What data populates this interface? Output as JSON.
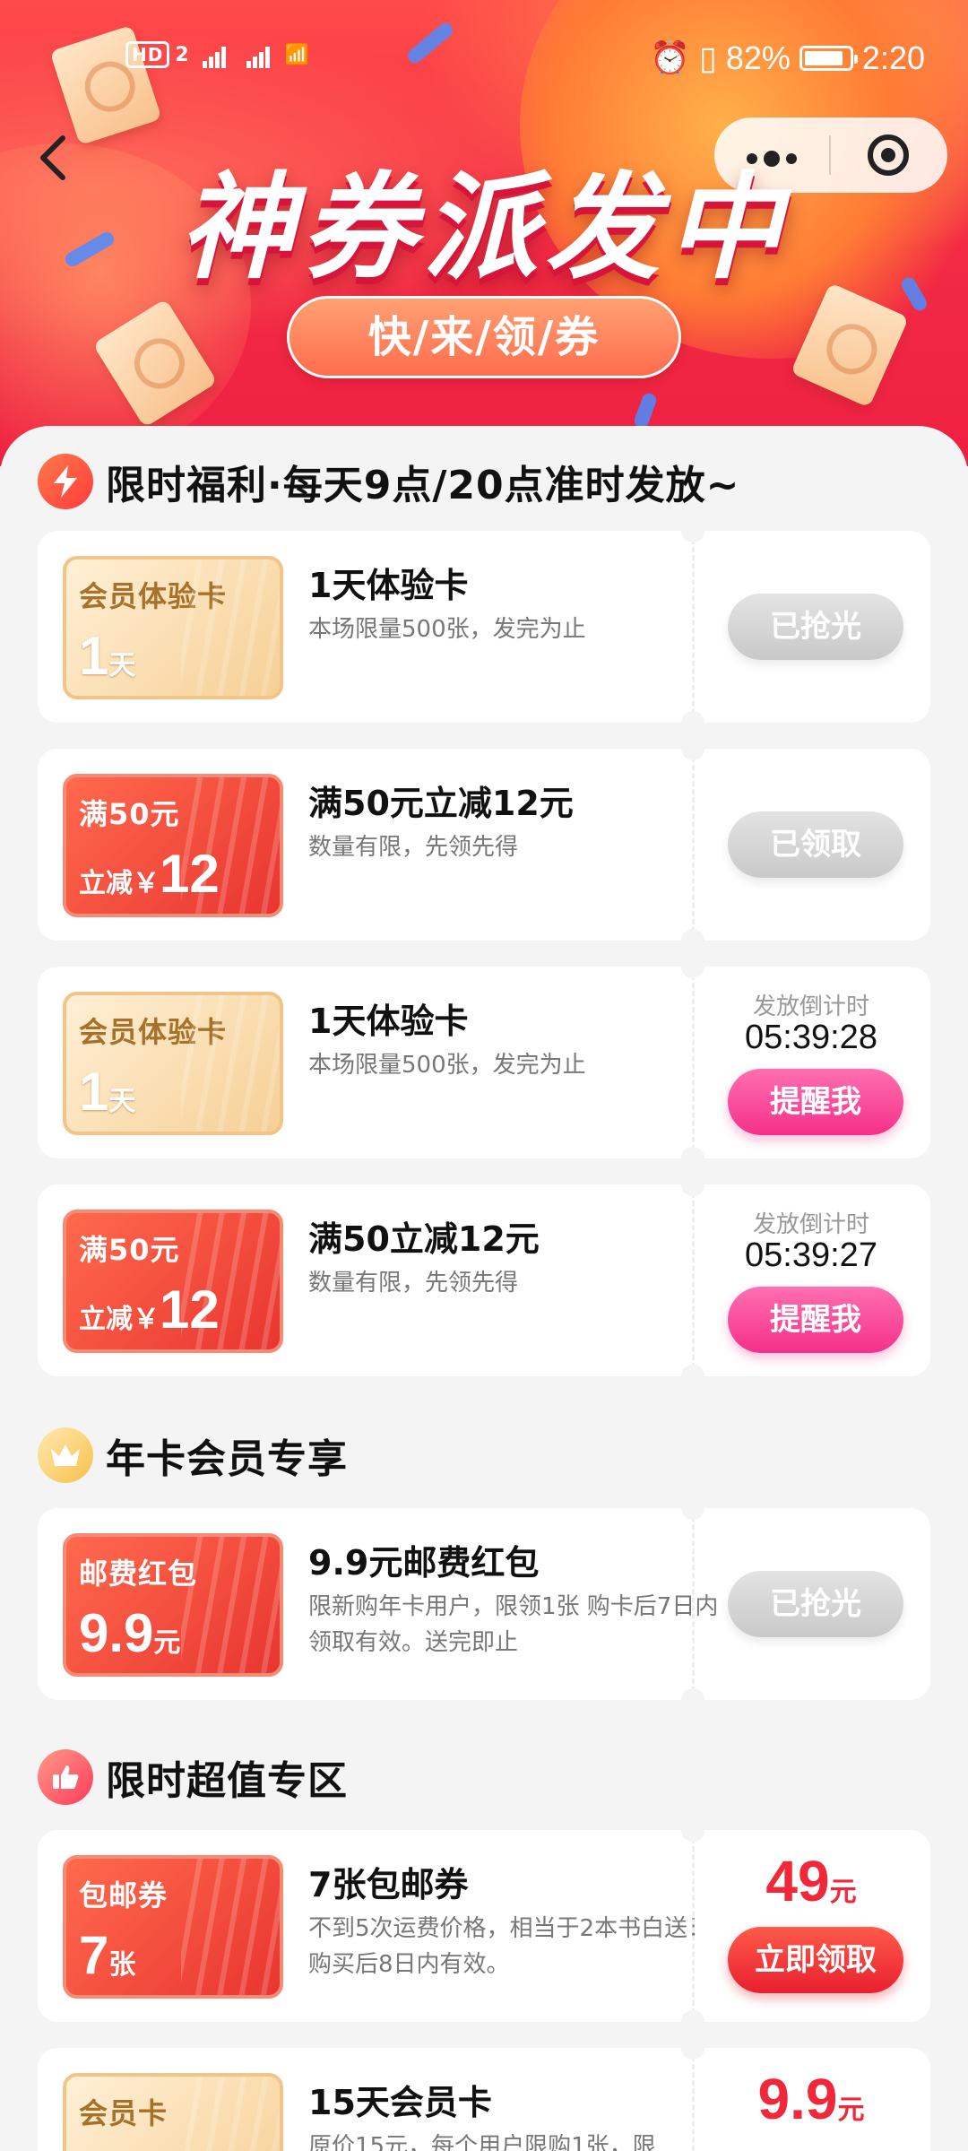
{
  "status": {
    "left": "HD 2 3G 4G",
    "battery_pct": "82%",
    "time": "2:20"
  },
  "banner": {
    "title": "神券派发中",
    "subtitle": "快/来/领/券",
    "back_icon": "chevron-left",
    "menu_icon": "more-dots",
    "target_icon": "target"
  },
  "section1": {
    "title": "限时福利·每天9点/20点准时发放~",
    "icon": "lightning-bolt",
    "cards": [
      {
        "ticket_style": "gold",
        "ticket_top": "会员体验卡",
        "ticket_big": "1",
        "ticket_small": "天",
        "title": "1天体验卡",
        "desc": "本场限量500张，发完为止",
        "button": "已抢光"
      },
      {
        "ticket_style": "red",
        "ticket_top": "满50元",
        "ticket_pre": "立减￥",
        "ticket_big": "12",
        "title": "满50元立减12元",
        "desc": "数量有限，先领先得",
        "button": "已领取"
      },
      {
        "ticket_style": "gold",
        "ticket_top": "会员体验卡",
        "ticket_big": "1",
        "ticket_small": "天",
        "title": "1天体验卡",
        "desc": "本场限量500张，发完为止",
        "countdown_label": "发放倒计时",
        "countdown_time": "05:39:28",
        "button": "提醒我"
      },
      {
        "ticket_style": "red",
        "ticket_top": "满50元",
        "ticket_pre": "立减￥",
        "ticket_big": "12",
        "title": "满50立减12元",
        "desc": "数量有限，先领先得",
        "countdown_label": "发放倒计时",
        "countdown_time": "05:39:27",
        "button": "提醒我"
      }
    ]
  },
  "section2": {
    "title": "年卡会员专享",
    "icon": "crown",
    "cards": [
      {
        "ticket_style": "red",
        "ticket_top": "邮费红包",
        "ticket_big": "9.9",
        "ticket_small": "元",
        "title": "9.9元邮费红包",
        "desc": "限新购年卡用户，限领1张 购卡后7日内领取有效。送完即止",
        "button": "已抢光"
      }
    ]
  },
  "section3": {
    "title": "限时超值专区",
    "icon": "thumbs-up",
    "cards": [
      {
        "ticket_style": "red",
        "ticket_top": "包邮券",
        "ticket_big": "7",
        "ticket_small": "张",
        "title": "7张包邮券",
        "desc": "不到5次运费价格，相当于2本书白送！购买后8日内有效。",
        "price": "49",
        "price_unit": "元",
        "button": "立即领取"
      },
      {
        "ticket_style": "gold",
        "ticket_top": "会员卡",
        "title": "15天会员卡",
        "desc": "原价15元，每个用户限购1张，限",
        "price": "9.9",
        "price_unit": "元"
      }
    ]
  },
  "colors": {
    "accent_red": "#f0283a",
    "remind_pink": "#f5308a",
    "disabled_gray": "#c9c9c9",
    "banner_red": "#f22a44"
  }
}
